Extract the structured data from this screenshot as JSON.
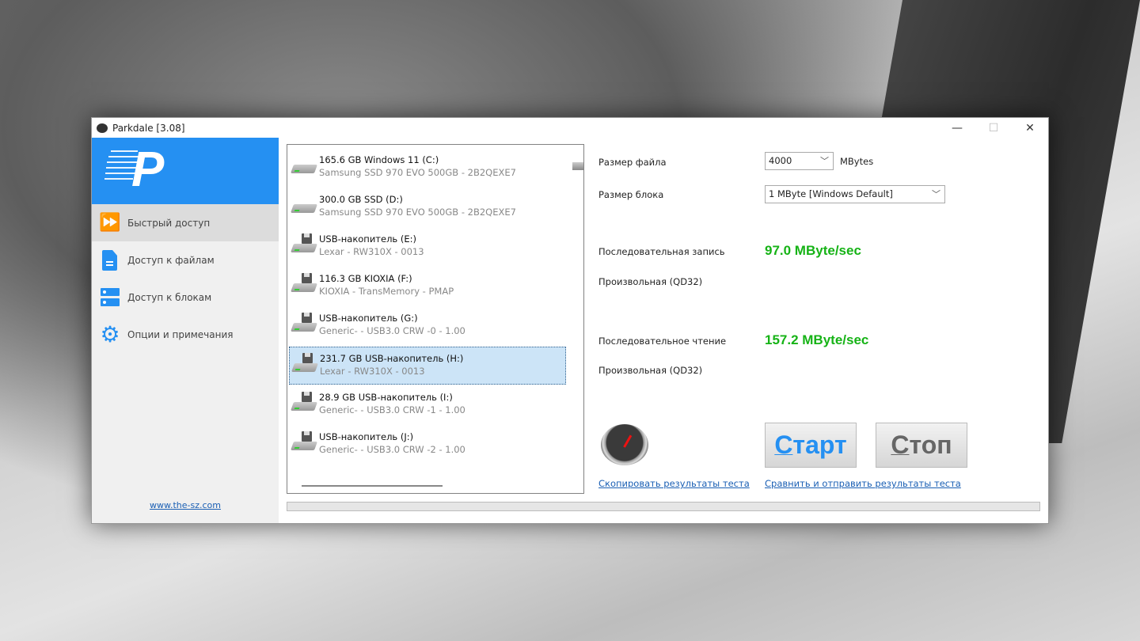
{
  "window": {
    "title": "Parkdale [3.08]",
    "minimize": "—",
    "maximize": "☐",
    "close": "✕"
  },
  "sidebar": {
    "items": [
      {
        "label": "Быстрый доступ",
        "icon": "fast-forward-icon"
      },
      {
        "label": "Доступ к файлам",
        "icon": "file-icon"
      },
      {
        "label": "Доступ к блокам",
        "icon": "server-blocks-icon"
      },
      {
        "label": "Опции и примечания",
        "icon": "gear-icon"
      }
    ],
    "website": "www.the-sz.com"
  },
  "drives": [
    {
      "name": "165.6 GB Windows 11 (C:)",
      "detail": "Samsung SSD 970 EVO 500GB - 2B2QEXE7",
      "usb": false
    },
    {
      "name": "300.0 GB SSD (D:)",
      "detail": "Samsung SSD 970 EVO 500GB - 2B2QEXE7",
      "usb": false
    },
    {
      "name": "USB-накопитель (E:)",
      "detail": "Lexar - RW310X - 0013",
      "usb": true
    },
    {
      "name": "116.3 GB KIOXIA (F:)",
      "detail": "KIOXIA - TransMemory - PMAP",
      "usb": true
    },
    {
      "name": "USB-накопитель (G:)",
      "detail": "Generic- - USB3.0 CRW    -0 - 1.00",
      "usb": true
    },
    {
      "name": "231.7 GB USB-накопитель (H:)",
      "detail": "Lexar - RW310X - 0013",
      "usb": true,
      "selected": true
    },
    {
      "name": "28.9 GB USB-накопитель (I:)",
      "detail": "Generic- - USB3.0 CRW    -1 - 1.00",
      "usb": true
    },
    {
      "name": "USB-накопитель (J:)",
      "detail": "Generic- - USB3.0 CRW    -2 - 1.00",
      "usb": true
    }
  ],
  "settings": {
    "file_size_label": "Размер файла",
    "file_size": "4000",
    "file_size_unit": "MBytes",
    "block_size_label": "Размер блока",
    "block_size": "1 MByte [Windows Default]"
  },
  "results": {
    "seq_write_label": "Последовательная запись",
    "seq_write": "97.0 MByte/sec",
    "rand_write_label": "Произвольная (QD32)",
    "seq_read_label": "Последовательное чтение",
    "seq_read": "157.2 MByte/sec",
    "rand_read_label": "Произвольная (QD32)"
  },
  "buttons": {
    "start_first": "С",
    "start_rest": "тарт",
    "stop_first": "С",
    "stop_rest": "топ"
  },
  "links": {
    "copy": "Скопировать результаты теста",
    "compare": "Сравнить и отправить результаты теста"
  },
  "progress": 0,
  "colors": {
    "accent": "#2590f2",
    "result": "#16b316",
    "selection": "#cce4f7"
  }
}
